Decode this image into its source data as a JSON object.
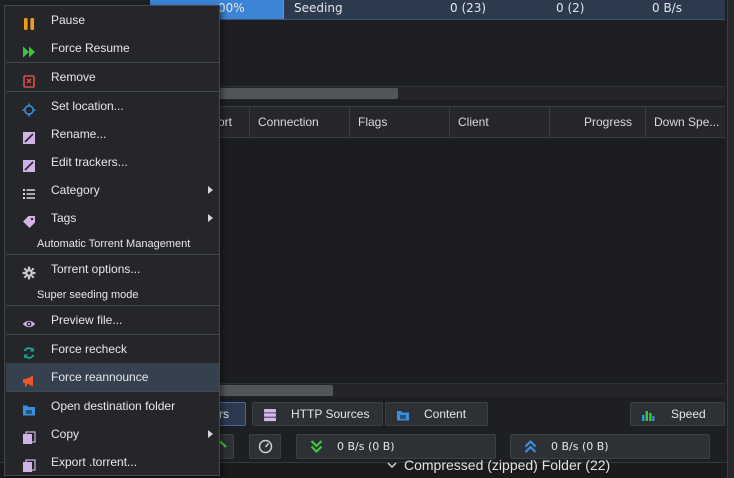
{
  "torrent_row": {
    "progress_text": "00%",
    "status": "Seeding",
    "seeds": "0 (23)",
    "peers": "0 (2)",
    "upload_speed": "0 B/s",
    "progress_fraction": 1.0
  },
  "peers_table": {
    "columns": [
      "ort",
      "Connection",
      "Flags",
      "Client",
      "Progress",
      "Down Spe..."
    ]
  },
  "tabs": {
    "peers_label": "rs",
    "http_sources_label": "HTTP Sources",
    "content_label": "Content",
    "speed_label": "Speed"
  },
  "status_bar": {
    "download": "0 B/s (0 B)",
    "upload": "0 B/s (0 B)"
  },
  "background_text": "Compressed (zipped) Folder (22)",
  "context_menu": {
    "items": [
      {
        "label": "Pause",
        "icon": "pause-icon",
        "color": "#f29a1d"
      },
      {
        "label": "Force Resume",
        "icon": "force-resume-icon",
        "color": "#3fc43f"
      },
      {
        "label": "Remove",
        "icon": "trash-icon",
        "color": "#e04b4b"
      },
      {
        "label": "Set location...",
        "icon": "location-icon",
        "color": "#3b8fe0"
      },
      {
        "label": "Rename...",
        "icon": "rename-icon",
        "color": "#d0b3e6"
      },
      {
        "label": "Edit trackers...",
        "icon": "edit-trackers-icon",
        "color": "#d0b3e6"
      },
      {
        "label": "Category",
        "icon": "list-icon",
        "color": "#d8d8d8"
      },
      {
        "label": "Tags",
        "icon": "tag-icon",
        "color": "#d6b3e8"
      },
      {
        "label": "Automatic Torrent Management"
      },
      {
        "label": "Torrent options...",
        "icon": "gear-icon",
        "color": "#cfcfcf"
      },
      {
        "label": "Super seeding mode"
      },
      {
        "label": "Preview file...",
        "icon": "eye-icon",
        "color": "#d0b3e6"
      },
      {
        "label": "Force recheck",
        "icon": "refresh-icon",
        "color": "#1aa59b"
      },
      {
        "label": "Force reannounce",
        "icon": "megaphone-icon",
        "color": "#e8562a"
      },
      {
        "label": "Open destination folder",
        "icon": "folder-icon",
        "color": "#3b8fe0"
      },
      {
        "label": "Copy",
        "icon": "copy-icon",
        "color": "#d0b3e6"
      },
      {
        "label": "Export .torrent...",
        "icon": "export-icon",
        "color": "#d0b3e6"
      }
    ]
  }
}
